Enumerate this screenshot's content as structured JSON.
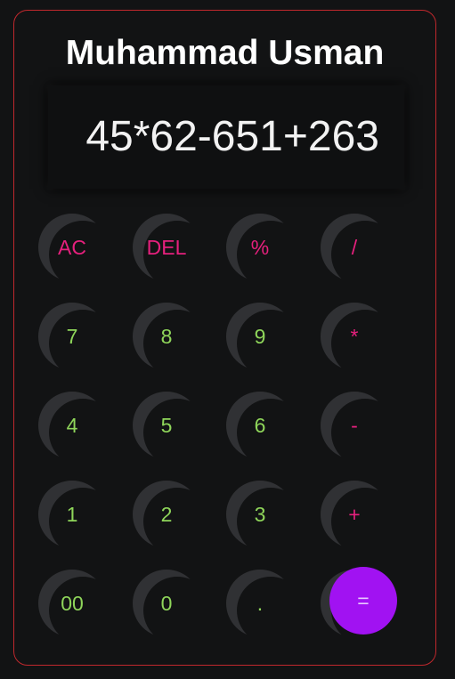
{
  "title": "Muhammad Usman",
  "display": "45*62-651+263",
  "keys": {
    "ac": "AC",
    "del": "DEL",
    "percent": "%",
    "divide": "/",
    "seven": "7",
    "eight": "8",
    "nine": "9",
    "multiply": "*",
    "four": "4",
    "five": "5",
    "six": "6",
    "minus": "-",
    "one": "1",
    "two": "2",
    "three": "3",
    "plus": "+",
    "double_zero": "00",
    "zero": "0",
    "dot": ".",
    "equals": "="
  },
  "colors": {
    "operator": "#e6207d",
    "number": "#8fd65a",
    "equals": "#a112f2",
    "border": "#c0282d"
  }
}
